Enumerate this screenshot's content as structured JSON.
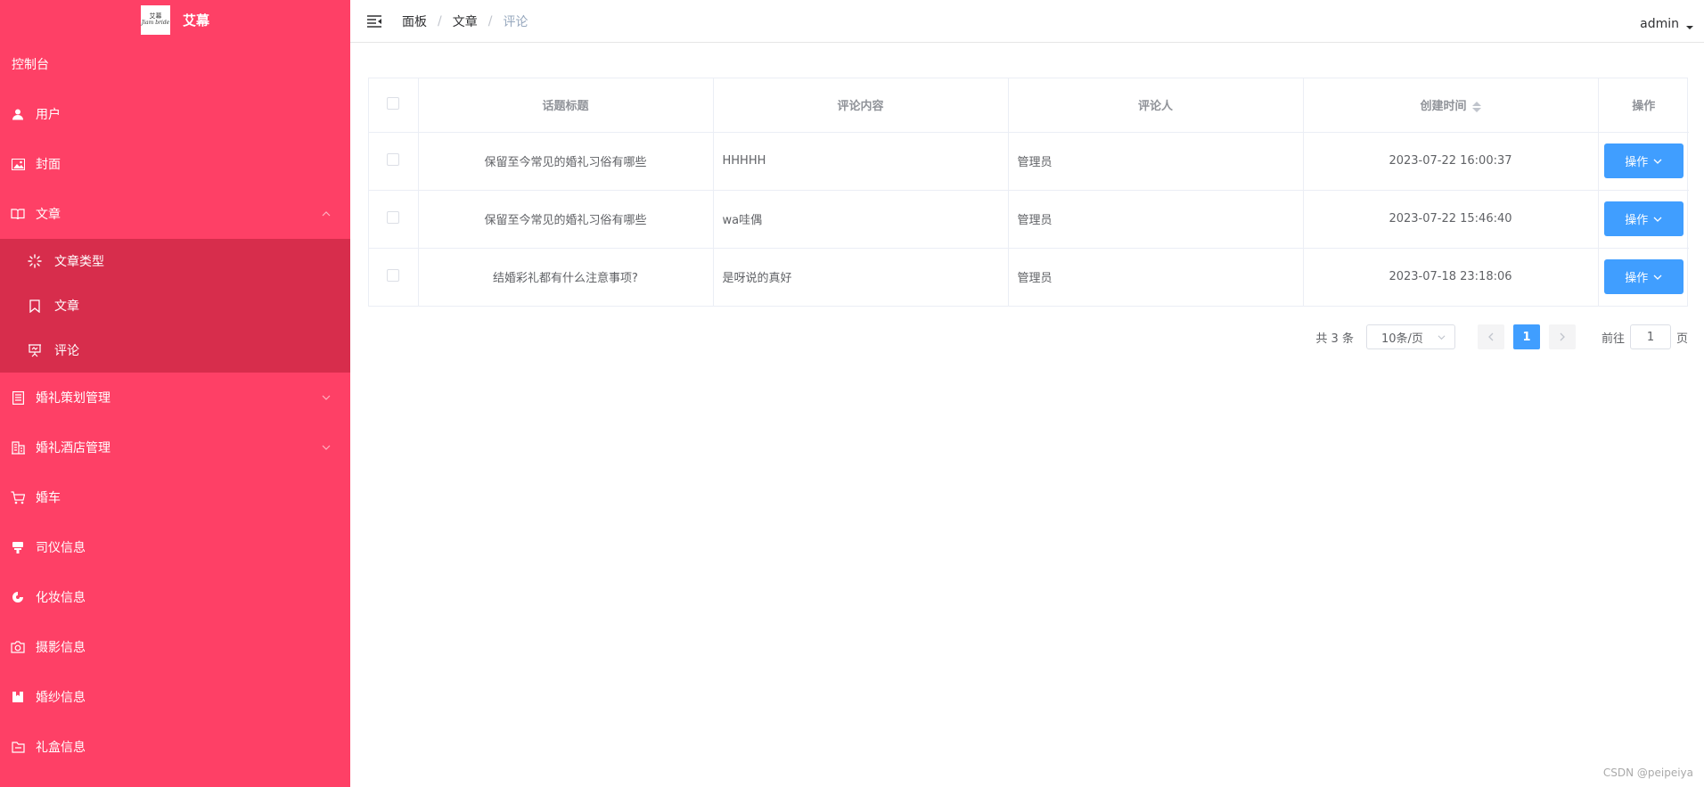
{
  "app": {
    "logo_text": "艾幕",
    "logo_small_top": "艾幕",
    "logo_small_bottom": "Jiam bride"
  },
  "sidebar": {
    "dashboard": "控制台",
    "items": [
      {
        "label": "用户",
        "icon": "user-icon"
      },
      {
        "label": "封面",
        "icon": "picture-icon"
      },
      {
        "label": "文章",
        "icon": "book-icon",
        "expanded": true
      },
      {
        "label": "婚礼策划管理",
        "icon": "notebook-icon"
      },
      {
        "label": "婚礼酒店管理",
        "icon": "building-icon"
      },
      {
        "label": "婚车",
        "icon": "cart-icon"
      },
      {
        "label": "司仪信息",
        "icon": "microphone-icon"
      },
      {
        "label": "化妆信息",
        "icon": "palette-icon"
      },
      {
        "label": "摄影信息",
        "icon": "camera-icon"
      },
      {
        "label": "婚纱信息",
        "icon": "suitcase-icon"
      },
      {
        "label": "礼盒信息",
        "icon": "folder-icon"
      }
    ],
    "submenu": [
      {
        "label": "文章类型",
        "icon": "loading-icon"
      },
      {
        "label": "文章",
        "icon": "bookmark-icon"
      },
      {
        "label": "评论",
        "icon": "presentation-icon"
      }
    ]
  },
  "header": {
    "breadcrumb": [
      "面板",
      "文章",
      "评论"
    ],
    "user": "admin"
  },
  "table": {
    "columns": [
      "话题标题",
      "评论内容",
      "评论人",
      "创建时间",
      "操作"
    ],
    "rows": [
      {
        "title": "保留至今常见的婚礼习俗有哪些",
        "content": "HHHHH",
        "user": "管理员",
        "time": "2023-07-22 16:00:37",
        "action": "操作"
      },
      {
        "title": "保留至今常见的婚礼习俗有哪些",
        "content": "wa哇偶",
        "user": "管理员",
        "time": "2023-07-22 15:46:40",
        "action": "操作"
      },
      {
        "title": "结婚彩礼都有什么注意事项?",
        "content": "是呀说的真好",
        "user": "管理员",
        "time": "2023-07-18 23:18:06",
        "action": "操作"
      }
    ]
  },
  "pagination": {
    "total": "共 3 条",
    "page_size": "10条/页",
    "current_page": "1",
    "goto_prefix": "前往",
    "goto_value": "1",
    "goto_suffix": "页"
  },
  "watermark": "CSDN @peipeiya",
  "colors": {
    "sidebar_bg": "#fe4066",
    "submenu_bg": "#d72d4c",
    "primary": "#409eff"
  }
}
